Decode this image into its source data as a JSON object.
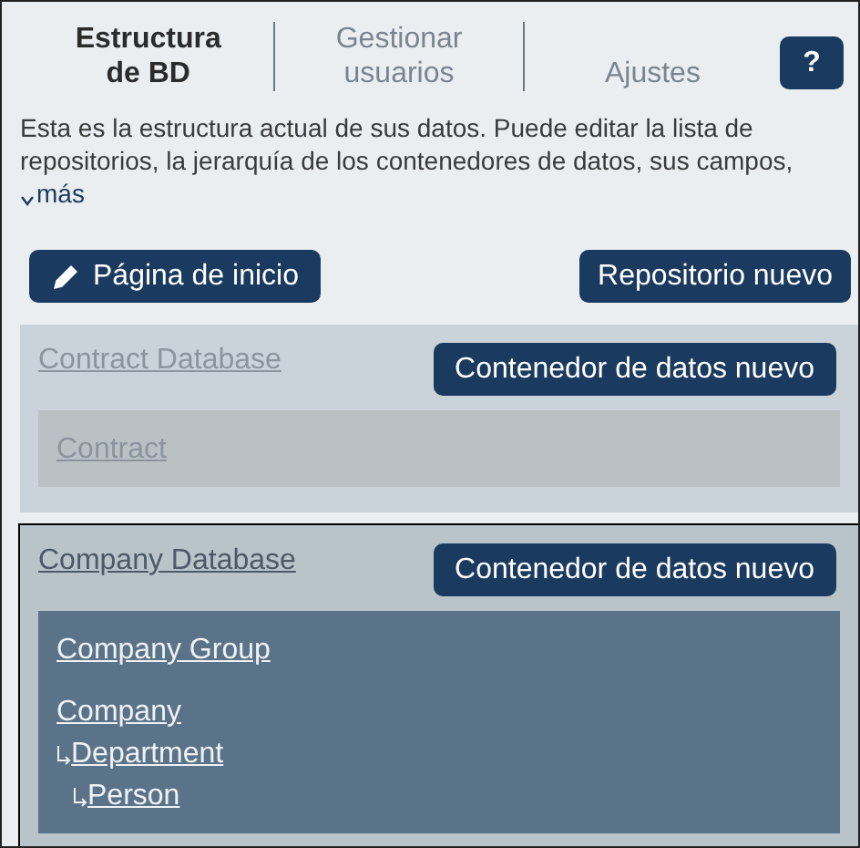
{
  "tabs": [
    {
      "label": "Estructura de BD",
      "selected": true
    },
    {
      "label": "Gestionar usuarios",
      "selected": false
    },
    {
      "label": "Ajustes",
      "selected": false
    }
  ],
  "help_button": "?",
  "description": {
    "text": "Esta es la estructura actual de sus datos. Puede editar la lista de repositorios, la jerarquía de los contenedores de datos, sus campos,",
    "more_link": "más"
  },
  "toolbar": {
    "home_button": "Página de inicio",
    "new_repository_button": "Repositorio nuevo"
  },
  "repositories": [
    {
      "name": "Contract Database",
      "selected": false,
      "new_container_button": "Contenedor de datos nuevo",
      "container_groups": [
        {
          "name": "Contract"
        }
      ]
    },
    {
      "name": "Company Database",
      "selected": true,
      "new_container_button": "Contenedor de datos nuevo",
      "container_groups": [
        {
          "name": "Company Group"
        },
        {
          "name": "Company",
          "children": [
            {
              "name": "Department",
              "children": [
                {
                  "name": "Person"
                }
              ]
            }
          ]
        }
      ]
    }
  ]
}
